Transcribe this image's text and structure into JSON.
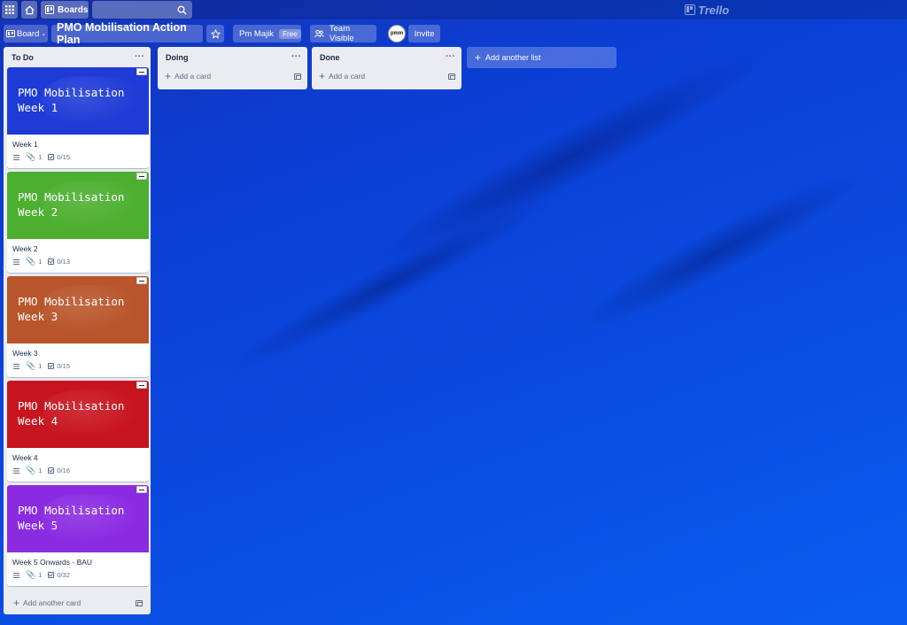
{
  "topbar": {
    "apps_icon": "apps-grid-icon",
    "home_icon": "home-icon",
    "boards_label": "Boards",
    "search_placeholder": "",
    "logo_text": "Trello"
  },
  "board": {
    "switcher_label": "Board",
    "title": "PMO Mobilisation Action Plan",
    "team_name": "Pm Majik",
    "team_plan": "Free",
    "visibility": "Team Visible",
    "member_avatar": "pmm",
    "invite_label": "Invite"
  },
  "lists": [
    {
      "name": "To Do",
      "add_card_label": "Add another card",
      "cards": [
        {
          "cover_text": "PMO Mobilisation\nWeek 1",
          "cover_color": "#1f3bd6",
          "title": "Week 1",
          "attachments": "1",
          "checklist": "0/15"
        },
        {
          "cover_text": "PMO Mobilisation\nWeek 2",
          "cover_color": "#4caf2f",
          "title": "Week 2",
          "attachments": "1",
          "checklist": "0/13"
        },
        {
          "cover_text": "PMO Mobilisation\nWeek 3",
          "cover_color": "#b8552a",
          "title": "Week 3",
          "attachments": "1",
          "checklist": "0/15"
        },
        {
          "cover_text": "PMO Mobilisation\nWeek 4",
          "cover_color": "#c8141e",
          "title": "Week 4",
          "attachments": "1",
          "checklist": "0/16"
        },
        {
          "cover_text": "PMO Mobilisation\nWeek 5",
          "cover_color": "#8a2be2",
          "title": "Week 5 Onwards - BAU",
          "attachments": "1",
          "checklist": "0/32"
        }
      ]
    },
    {
      "name": "Doing",
      "add_card_label": "Add a card",
      "cards": []
    },
    {
      "name": "Done",
      "add_card_label": "Add a card",
      "cards": []
    }
  ],
  "add_list_label": "Add another list",
  "colors": {
    "background": "#0b46dc",
    "list_bg": "#ebecf0"
  }
}
